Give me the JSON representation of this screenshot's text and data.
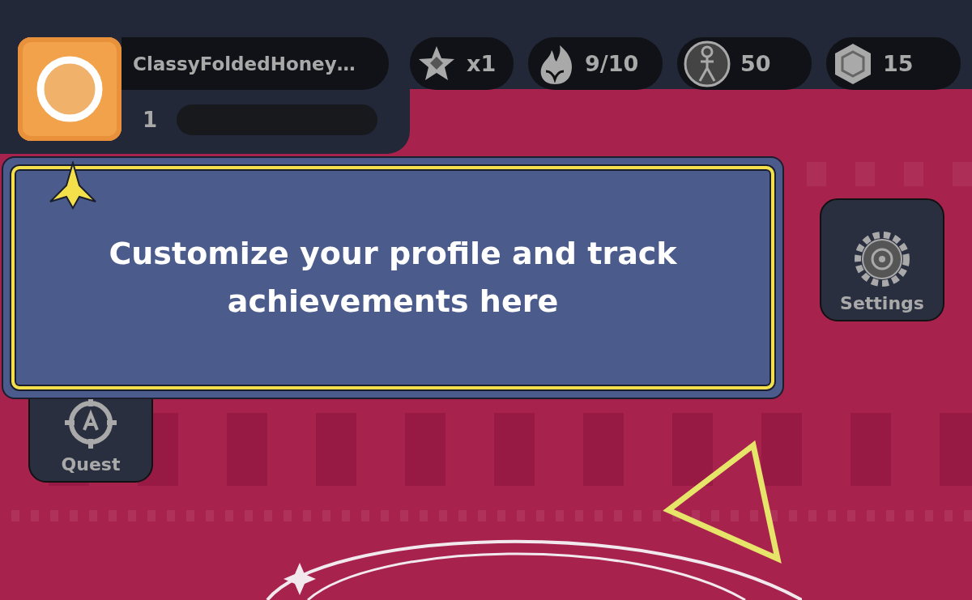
{
  "profile": {
    "name": "ClassyFoldedHoney…",
    "level": "1"
  },
  "currencies": [
    {
      "kind": "star",
      "value": "x1"
    },
    {
      "kind": "flame",
      "value": "9/10"
    },
    {
      "kind": "coin",
      "value": "50"
    },
    {
      "kind": "gem",
      "value": "15"
    }
  ],
  "tooltip": {
    "text": "Customize your profile and track achievements here"
  },
  "buttons": [
    {
      "kind": "settings",
      "label": "Settings"
    },
    {
      "kind": "quest",
      "label": "Quest"
    }
  ]
}
